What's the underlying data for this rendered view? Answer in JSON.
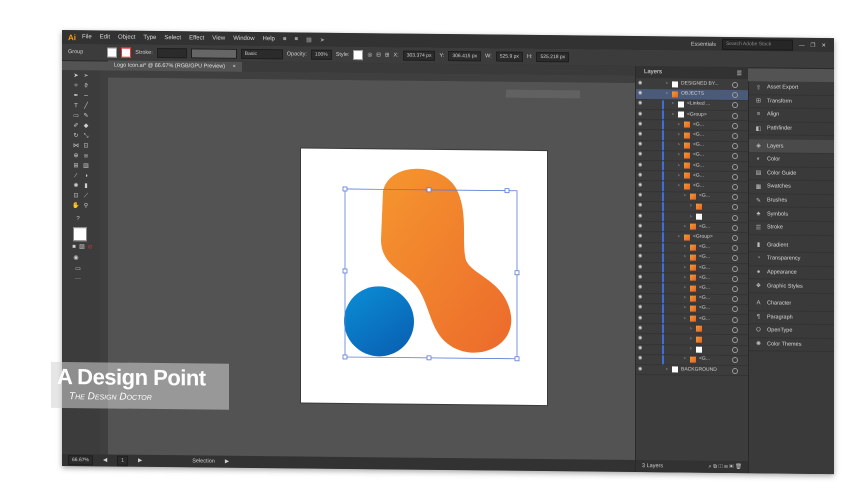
{
  "app": {
    "logo": "Ai",
    "workspace": "Essentials",
    "search_placeholder": "Search Adobe Stock"
  },
  "menu": [
    "File",
    "Edit",
    "Object",
    "Type",
    "Select",
    "Effect",
    "View",
    "Window",
    "Help"
  ],
  "control_bar": {
    "selection_type": "Group",
    "stroke_label": "Stroke:",
    "brush": "Basic",
    "opacity_label": "Opacity:",
    "opacity_value": "100%",
    "style_label": "Style:",
    "x_label": "X:",
    "x_value": "303.374 px",
    "y_label": "Y:",
    "y_value": "306.415 px",
    "w_label": "W:",
    "w_value": "525.9 px",
    "h_label": "H:",
    "h_value": "525.218 px"
  },
  "document": {
    "tab_title": "Logo Icon.ai* @ 66.67% (RGB/GPU Preview)",
    "close_label": "×"
  },
  "status": {
    "zoom": "66.67%",
    "artboard_number": "1",
    "tool": "Selection"
  },
  "layers_panel": {
    "tab_label": "Layers",
    "rows": [
      {
        "name": "DESIGNED BY...",
        "indent": 0,
        "thumb": "white"
      },
      {
        "name": "OBJECTS",
        "indent": 0,
        "thumb": "orange",
        "selected": true
      },
      {
        "name": "<Linked ...",
        "indent": 1,
        "thumb": "white"
      },
      {
        "name": "<Group>",
        "indent": 1,
        "thumb": "white"
      },
      {
        "name": "<G...",
        "indent": 2,
        "thumb": "orange"
      },
      {
        "name": "<G...",
        "indent": 2,
        "thumb": "orange"
      },
      {
        "name": "<G...",
        "indent": 2,
        "thumb": "orange"
      },
      {
        "name": "<G...",
        "indent": 2,
        "thumb": "orange"
      },
      {
        "name": "<G...",
        "indent": 2,
        "thumb": "orange"
      },
      {
        "name": "<G...",
        "indent": 2,
        "thumb": "orange"
      },
      {
        "name": "<G...",
        "indent": 2,
        "thumb": "orange"
      },
      {
        "name": "<G...",
        "indent": 3,
        "thumb": "orange"
      },
      {
        "name": "",
        "indent": 4,
        "thumb": "orange"
      },
      {
        "name": "",
        "indent": 4,
        "thumb": "white"
      },
      {
        "name": "<G...",
        "indent": 3,
        "thumb": "orange"
      },
      {
        "name": "<Group>",
        "indent": 2,
        "thumb": "orange"
      },
      {
        "name": "<G...",
        "indent": 3,
        "thumb": "orange"
      },
      {
        "name": "<G...",
        "indent": 3,
        "thumb": "orange"
      },
      {
        "name": "<G...",
        "indent": 3,
        "thumb": "orange"
      },
      {
        "name": "<G...",
        "indent": 3,
        "thumb": "orange"
      },
      {
        "name": "<G...",
        "indent": 3,
        "thumb": "orange"
      },
      {
        "name": "<G...",
        "indent": 3,
        "thumb": "orange"
      },
      {
        "name": "<G...",
        "indent": 3,
        "thumb": "orange"
      },
      {
        "name": "<G...",
        "indent": 3,
        "thumb": "orange"
      },
      {
        "name": "",
        "indent": 4,
        "thumb": "orange"
      },
      {
        "name": "",
        "indent": 4,
        "thumb": "orange"
      },
      {
        "name": "",
        "indent": 4,
        "thumb": "white"
      },
      {
        "name": "<G...",
        "indent": 3,
        "thumb": "orange"
      },
      {
        "name": "BACKGROUND",
        "indent": 0,
        "thumb": "white"
      }
    ],
    "footer": "3 Layers"
  },
  "panels": [
    {
      "label": "Asset Export",
      "icon": "asset-export-icon",
      "glyph": "⇪"
    },
    {
      "label": "Transform",
      "icon": "transform-icon",
      "glyph": "⊞"
    },
    {
      "label": "Align",
      "icon": "align-icon",
      "glyph": "≡"
    },
    {
      "label": "Pathfinder",
      "icon": "pathfinder-icon",
      "glyph": "◧"
    },
    {
      "label": "Layers",
      "icon": "layers-icon",
      "glyph": "◈",
      "active": true
    },
    {
      "label": "Color",
      "icon": "color-icon",
      "glyph": "◐"
    },
    {
      "label": "Color Guide",
      "icon": "color-guide-icon",
      "glyph": "▤"
    },
    {
      "label": "Swatches",
      "icon": "swatches-icon",
      "glyph": "▦"
    },
    {
      "label": "Brushes",
      "icon": "brushes-icon",
      "glyph": "✎"
    },
    {
      "label": "Symbols",
      "icon": "symbols-icon",
      "glyph": "♣"
    },
    {
      "label": "Stroke",
      "icon": "stroke-icon",
      "glyph": "☰"
    },
    {
      "label": "Gradient",
      "icon": "gradient-icon",
      "glyph": "▮"
    },
    {
      "label": "Transparency",
      "icon": "transparency-icon",
      "glyph": "◔"
    },
    {
      "label": "Appearance",
      "icon": "appearance-icon",
      "glyph": "●"
    },
    {
      "label": "Graphic Styles",
      "icon": "graphic-styles-icon",
      "glyph": "❖"
    },
    {
      "label": "Character",
      "icon": "character-icon",
      "glyph": "A"
    },
    {
      "label": "Paragraph",
      "icon": "paragraph-icon",
      "glyph": "¶"
    },
    {
      "label": "OpenType",
      "icon": "opentype-icon",
      "glyph": "O"
    },
    {
      "label": "Color Themes",
      "icon": "color-themes-icon",
      "glyph": "✺"
    }
  ],
  "watermark": {
    "title": "A Design Point",
    "subtitle": "The Design Doctor"
  },
  "colors": {
    "orange_start": "#f5962e",
    "orange_end": "#ec6a2c",
    "blue_start": "#0a8fd6",
    "blue_end": "#0a62b4",
    "selection": "#5a7bd8",
    "ai_brand": "#ff9a00"
  }
}
